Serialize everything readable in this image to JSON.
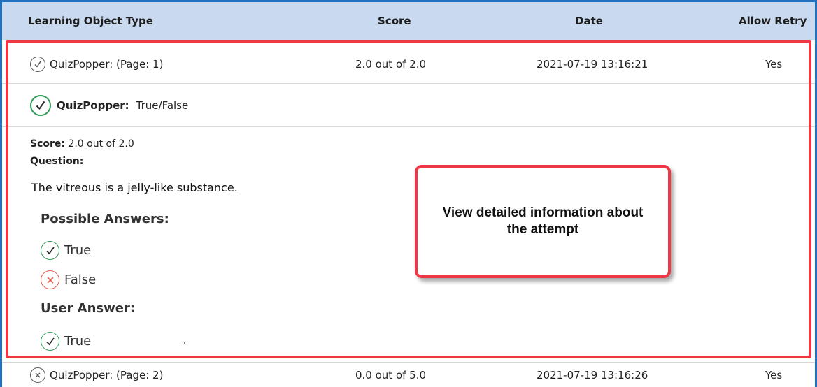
{
  "table": {
    "headers": {
      "type": "Learning Object Type",
      "score": "Score",
      "date": "Date",
      "retry": "Allow Retry"
    },
    "rows": [
      {
        "type": "QuizPopper: (Page: 1)",
        "score": "2.0 out of 2.0",
        "date": "2021-07-19 13:16:21",
        "retry": "Yes",
        "status_icon": "check-circle-icon"
      },
      {
        "type": "QuizPopper: (Page: 2)",
        "score": "0.0 out of 5.0",
        "date": "2021-07-19 13:16:26",
        "retry": "Yes",
        "status_icon": "x-circle-icon"
      }
    ]
  },
  "detail_header": {
    "title": "QuizPopper:",
    "kind": "True/False",
    "icon": "check-circle-icon"
  },
  "detail": {
    "score_label": "Score:",
    "score_value": "2.0 out of 2.0",
    "question_label": "Question:",
    "question_text": "The vitreous is a jelly-like substance.",
    "possible_label": "Possible Answers:",
    "answers": [
      {
        "text": "True",
        "icon": "check-circle-icon"
      },
      {
        "text": "False",
        "icon": "x-circle-icon"
      }
    ],
    "user_label": "User Answer:",
    "user_answer": {
      "text": "True",
      "icon": "check-circle-icon"
    }
  },
  "callout": {
    "text": "View detailed information about the attempt"
  },
  "colors": {
    "header_bg": "#c9daf0",
    "frame_blue": "#1f73c2",
    "highlight_red": "#ee3845",
    "correct_green": "#2e9a55",
    "wrong_red": "#e35a4c"
  }
}
